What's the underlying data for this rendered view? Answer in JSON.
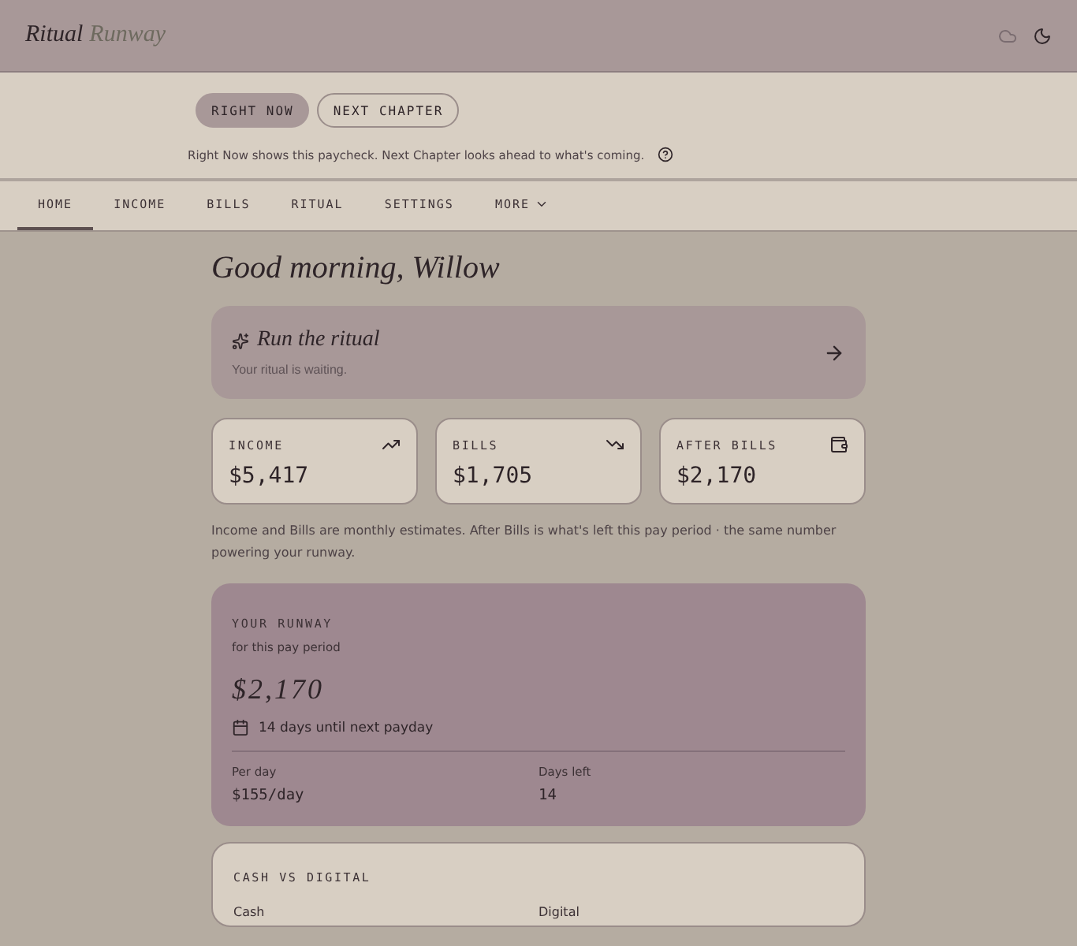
{
  "header": {
    "brand_first": "Ritual",
    "brand_second": "Runway"
  },
  "modes": [
    {
      "label": "RIGHT NOW",
      "selected": true
    },
    {
      "label": "NEXT CHAPTER",
      "selected": false
    }
  ],
  "mode_hint": "Right Now shows this paycheck. Next Chapter looks ahead to what's coming.",
  "nav": [
    {
      "label": "HOME",
      "selected": true,
      "kind": "tab"
    },
    {
      "label": "INCOME",
      "selected": false,
      "kind": "tab"
    },
    {
      "label": "BILLS",
      "selected": false,
      "kind": "tab"
    },
    {
      "label": "RITUAL",
      "selected": false,
      "kind": "tab"
    },
    {
      "label": "SETTINGS",
      "selected": false,
      "kind": "tab"
    },
    {
      "label": "MORE",
      "selected": false,
      "kind": "menu"
    }
  ],
  "greeting": "Good morning, Willow",
  "ritual_card": {
    "title": "Run the ritual",
    "subtitle": "Your ritual is waiting."
  },
  "stats": [
    {
      "label": "INCOME",
      "value": "$5,417",
      "kind": "up"
    },
    {
      "label": "BILLS",
      "value": "$1,705",
      "kind": "down"
    },
    {
      "label": "AFTER BILLS",
      "value": "$2,170",
      "kind": "wallet"
    }
  ],
  "note": "Income and Bills are monthly estimates. After Bills is what's left this pay period · the same number powering your runway.",
  "runway": {
    "title": "YOUR RUNWAY",
    "subtitle": "for this pay period",
    "amount": "$2,170",
    "payday": "14 days until next payday",
    "metrics": [
      {
        "label": "Per day",
        "value": "$155/day"
      },
      {
        "label": "Days left",
        "value": "14"
      }
    ]
  },
  "cash_card": {
    "title": "CASH VS DIGITAL",
    "columns": [
      "Cash",
      "Digital"
    ]
  }
}
